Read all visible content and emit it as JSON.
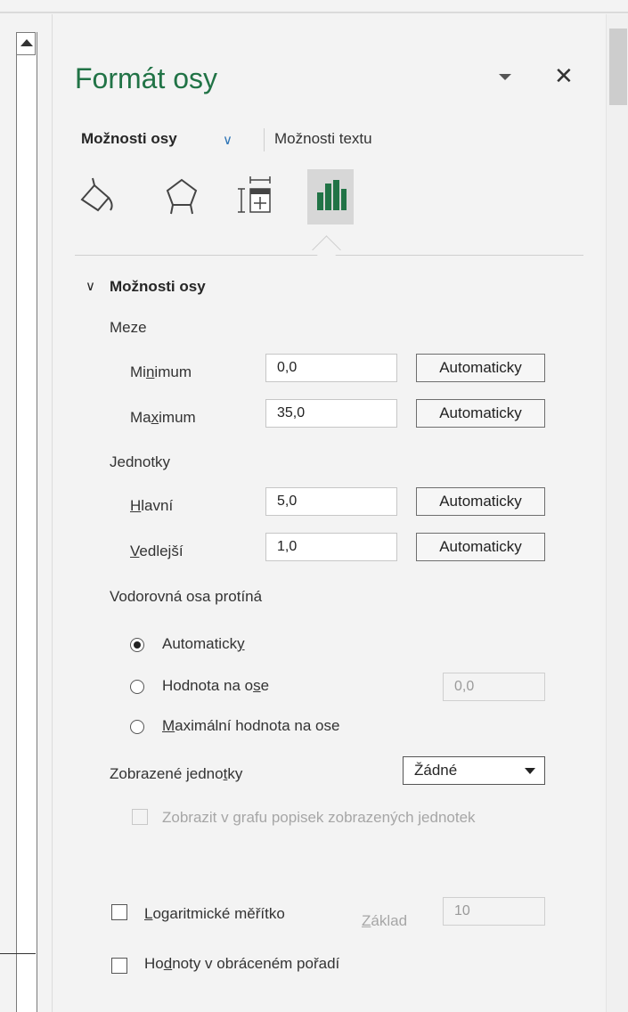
{
  "panel": {
    "title": "Formát osy",
    "tabs": {
      "axis_options": "Možnosti osy",
      "text_options": "Možnosti textu"
    },
    "icons": [
      "fill-line-icon",
      "effects-icon",
      "size-properties-icon",
      "axis-options-icon"
    ],
    "accent_color": "#217346"
  },
  "section": {
    "title": "Možnosti osy",
    "bounds_label": "Meze",
    "minimum": {
      "label": "Minimum",
      "value": "0,0",
      "button": "Automaticky"
    },
    "maximum": {
      "label": "Maximum",
      "value": "35,0",
      "button": "Automaticky"
    },
    "units_label": "Jednotky",
    "major": {
      "label": "Hlavní",
      "value": "5,0",
      "button": "Automaticky"
    },
    "minor": {
      "label": "Vedlejší",
      "value": "1,0",
      "button": "Automaticky"
    },
    "crosses_label": "Vodorovná osa protíná",
    "crosses_options": {
      "auto": "Automaticky",
      "value": "Hodnota na ose",
      "value_input": "0,0",
      "max": "Maximální hodnota na ose"
    },
    "display_units_label": "Zobrazené jednotky",
    "display_units_value": "Žádné",
    "show_units_label": "Zobrazit v grafu popisek zobrazených jednotek",
    "log_scale_label": "Logaritmické měřítko",
    "base_label": "Základ",
    "base_value": "10",
    "reverse_label": "Hodnoty v obráceném pořadí"
  }
}
